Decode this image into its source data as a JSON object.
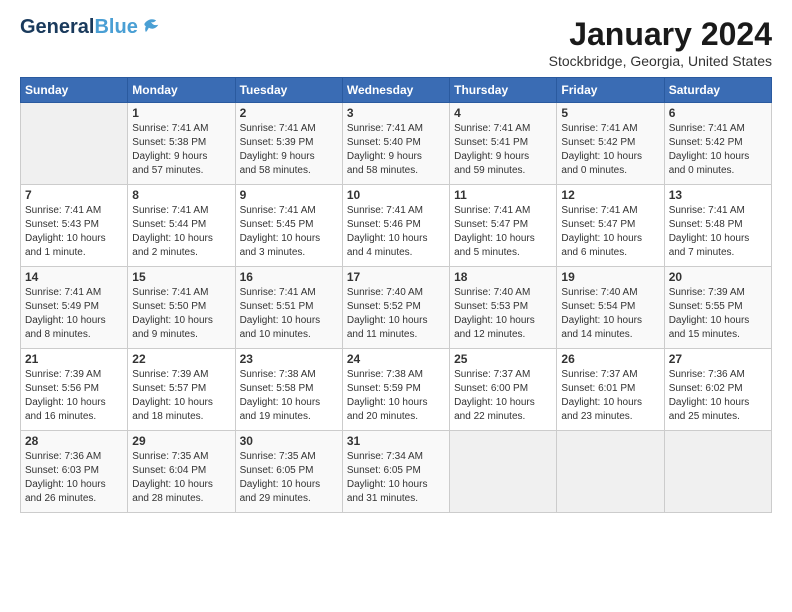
{
  "logo": {
    "general": "General",
    "blue": "Blue"
  },
  "header": {
    "month": "January 2024",
    "location": "Stockbridge, Georgia, United States"
  },
  "days_header": [
    "Sunday",
    "Monday",
    "Tuesday",
    "Wednesday",
    "Thursday",
    "Friday",
    "Saturday"
  ],
  "weeks": [
    [
      {
        "day": "",
        "info": ""
      },
      {
        "day": "1",
        "info": "Sunrise: 7:41 AM\nSunset: 5:38 PM\nDaylight: 9 hours\nand 57 minutes."
      },
      {
        "day": "2",
        "info": "Sunrise: 7:41 AM\nSunset: 5:39 PM\nDaylight: 9 hours\nand 58 minutes."
      },
      {
        "day": "3",
        "info": "Sunrise: 7:41 AM\nSunset: 5:40 PM\nDaylight: 9 hours\nand 58 minutes."
      },
      {
        "day": "4",
        "info": "Sunrise: 7:41 AM\nSunset: 5:41 PM\nDaylight: 9 hours\nand 59 minutes."
      },
      {
        "day": "5",
        "info": "Sunrise: 7:41 AM\nSunset: 5:42 PM\nDaylight: 10 hours\nand 0 minutes."
      },
      {
        "day": "6",
        "info": "Sunrise: 7:41 AM\nSunset: 5:42 PM\nDaylight: 10 hours\nand 0 minutes."
      }
    ],
    [
      {
        "day": "7",
        "info": "Sunrise: 7:41 AM\nSunset: 5:43 PM\nDaylight: 10 hours\nand 1 minute."
      },
      {
        "day": "8",
        "info": "Sunrise: 7:41 AM\nSunset: 5:44 PM\nDaylight: 10 hours\nand 2 minutes."
      },
      {
        "day": "9",
        "info": "Sunrise: 7:41 AM\nSunset: 5:45 PM\nDaylight: 10 hours\nand 3 minutes."
      },
      {
        "day": "10",
        "info": "Sunrise: 7:41 AM\nSunset: 5:46 PM\nDaylight: 10 hours\nand 4 minutes."
      },
      {
        "day": "11",
        "info": "Sunrise: 7:41 AM\nSunset: 5:47 PM\nDaylight: 10 hours\nand 5 minutes."
      },
      {
        "day": "12",
        "info": "Sunrise: 7:41 AM\nSunset: 5:47 PM\nDaylight: 10 hours\nand 6 minutes."
      },
      {
        "day": "13",
        "info": "Sunrise: 7:41 AM\nSunset: 5:48 PM\nDaylight: 10 hours\nand 7 minutes."
      }
    ],
    [
      {
        "day": "14",
        "info": "Sunrise: 7:41 AM\nSunset: 5:49 PM\nDaylight: 10 hours\nand 8 minutes."
      },
      {
        "day": "15",
        "info": "Sunrise: 7:41 AM\nSunset: 5:50 PM\nDaylight: 10 hours\nand 9 minutes."
      },
      {
        "day": "16",
        "info": "Sunrise: 7:41 AM\nSunset: 5:51 PM\nDaylight: 10 hours\nand 10 minutes."
      },
      {
        "day": "17",
        "info": "Sunrise: 7:40 AM\nSunset: 5:52 PM\nDaylight: 10 hours\nand 11 minutes."
      },
      {
        "day": "18",
        "info": "Sunrise: 7:40 AM\nSunset: 5:53 PM\nDaylight: 10 hours\nand 12 minutes."
      },
      {
        "day": "19",
        "info": "Sunrise: 7:40 AM\nSunset: 5:54 PM\nDaylight: 10 hours\nand 14 minutes."
      },
      {
        "day": "20",
        "info": "Sunrise: 7:39 AM\nSunset: 5:55 PM\nDaylight: 10 hours\nand 15 minutes."
      }
    ],
    [
      {
        "day": "21",
        "info": "Sunrise: 7:39 AM\nSunset: 5:56 PM\nDaylight: 10 hours\nand 16 minutes."
      },
      {
        "day": "22",
        "info": "Sunrise: 7:39 AM\nSunset: 5:57 PM\nDaylight: 10 hours\nand 18 minutes."
      },
      {
        "day": "23",
        "info": "Sunrise: 7:38 AM\nSunset: 5:58 PM\nDaylight: 10 hours\nand 19 minutes."
      },
      {
        "day": "24",
        "info": "Sunrise: 7:38 AM\nSunset: 5:59 PM\nDaylight: 10 hours\nand 20 minutes."
      },
      {
        "day": "25",
        "info": "Sunrise: 7:37 AM\nSunset: 6:00 PM\nDaylight: 10 hours\nand 22 minutes."
      },
      {
        "day": "26",
        "info": "Sunrise: 7:37 AM\nSunset: 6:01 PM\nDaylight: 10 hours\nand 23 minutes."
      },
      {
        "day": "27",
        "info": "Sunrise: 7:36 AM\nSunset: 6:02 PM\nDaylight: 10 hours\nand 25 minutes."
      }
    ],
    [
      {
        "day": "28",
        "info": "Sunrise: 7:36 AM\nSunset: 6:03 PM\nDaylight: 10 hours\nand 26 minutes."
      },
      {
        "day": "29",
        "info": "Sunrise: 7:35 AM\nSunset: 6:04 PM\nDaylight: 10 hours\nand 28 minutes."
      },
      {
        "day": "30",
        "info": "Sunrise: 7:35 AM\nSunset: 6:05 PM\nDaylight: 10 hours\nand 29 minutes."
      },
      {
        "day": "31",
        "info": "Sunrise: 7:34 AM\nSunset: 6:05 PM\nDaylight: 10 hours\nand 31 minutes."
      },
      {
        "day": "",
        "info": ""
      },
      {
        "day": "",
        "info": ""
      },
      {
        "day": "",
        "info": ""
      }
    ]
  ]
}
